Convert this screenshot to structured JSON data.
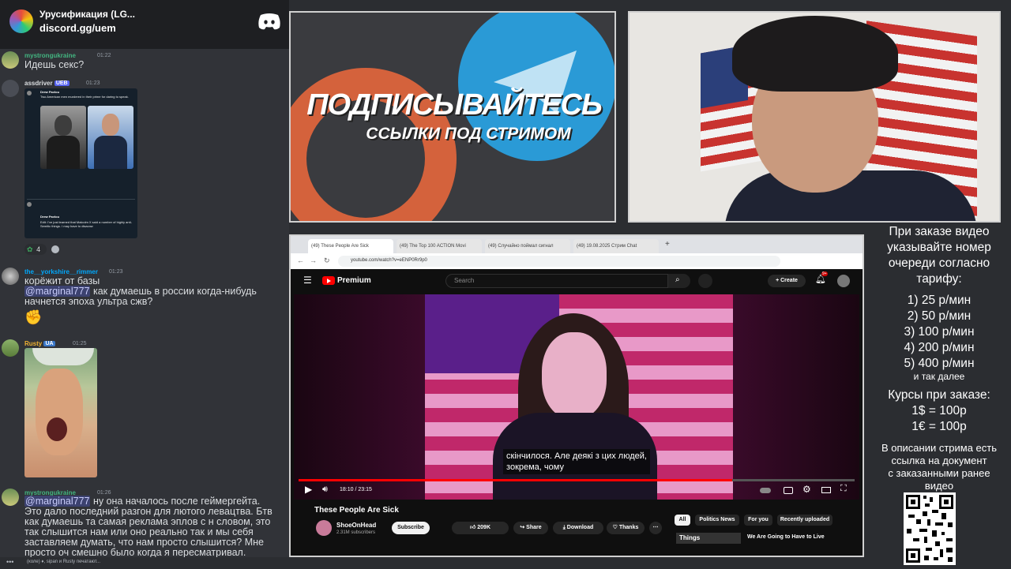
{
  "discord": {
    "server_name": "Урусификация (LG...",
    "server_link": "discord.gg/uem",
    "messages": [
      {
        "user": "mystrongukraine",
        "time": "01:22",
        "text": "Идешь секс?"
      },
      {
        "user": "assdriver",
        "badge": "UEB",
        "time": "01:23",
        "tweet_author": "Drew Pavlou",
        "tweet_text": "Two American men murdered in their prime for daring to speak.",
        "tweet2_text": "Edit: I've just learned that Malcolm X said a number of highly anti-Semitic things. I may have to disavow",
        "reaction_count": "4"
      },
      {
        "user": "the__yorkshire__rimmer",
        "time": "01:23",
        "line1": "корёжит от базы",
        "mention": "@marginal777",
        "line2": " как думаешь в россии когда-нибудь",
        "line3": "начнется эпоха ультра сжв?"
      },
      {
        "user": "Rusty",
        "badge": "UA",
        "time": "01:25"
      },
      {
        "user": "mystrongukraine",
        "time": "01:26",
        "mention": "@marginal777",
        "line1": " ну она началось после геймергейта.",
        "line2": "Это дало последний разгон для лютого левацтва. Бтв",
        "line3": "как думаешь та самая реклама эплов с н словом, это",
        "line4": "так слышится нам или оно реально так и мы себя",
        "line5": "заставляем думать, что нам просто слышится? Мне",
        "line6": "просто оч смешно было когда я пересматривал."
      }
    ],
    "typing": "(коле) ♦, sipan и Rusty печатают..."
  },
  "promo": {
    "title": "ПОДПИСЫВАЙТЕСЬ",
    "subtitle": "ССЫЛКИ ПОД СТРИМОМ"
  },
  "browser": {
    "tabs": [
      "(49) These People Are Sick",
      "(49) The Top 100 ACTION Movi",
      "(49) Случайно поймал сигнал",
      "(49) 19.08.2025 Стрим Chat"
    ],
    "url": "youtube.com/watch?v=eENP0Rr9p0",
    "yt": {
      "logo": "Premium",
      "search_placeholder": "Search",
      "create": "Create",
      "notif_count": "9+",
      "subtitle_line1": "скінчилося.  Але деякі з цих людей,",
      "subtitle_line2": "зокрема, чому",
      "time": "18:10 / 23:15",
      "progress": 0.78,
      "video_title": "These People Are Sick",
      "channel": "ShoeOnHead",
      "subscribers": "2.31M subscribers",
      "subscribe": "Subscribe",
      "likes": "209K",
      "share": "Share",
      "download": "Download",
      "thanks": "Thanks",
      "chips": [
        "All",
        "Politics News",
        "For you",
        "Recently uploaded"
      ],
      "rec_title": "We Are Going to Have to Live",
      "rec_thumb_text": "Things"
    }
  },
  "info": {
    "line1": "При заказе видео",
    "line2": "указывайте номер",
    "line3": "очереди согласно",
    "line4": "тарифу:",
    "rates": [
      "1) 25 р/мин",
      "2) 50 р/мин",
      "3) 100 р/мин",
      "4) 200 р/мин",
      "5) 400 р/мин"
    ],
    "etc": "и так далее",
    "courses_title": "Курсы при заказе:",
    "usd": "1$ = 100р",
    "eur": "1€ = 100р",
    "desc1": "В описании стрима есть",
    "desc2": "ссылка на документ",
    "desc3": "с заказанными ранее",
    "desc4": "видео"
  },
  "colors": {
    "discord_bg": "#313338",
    "mention": "#3c4270",
    "yt_red": "#ff0000",
    "link": "#00a8fc"
  }
}
